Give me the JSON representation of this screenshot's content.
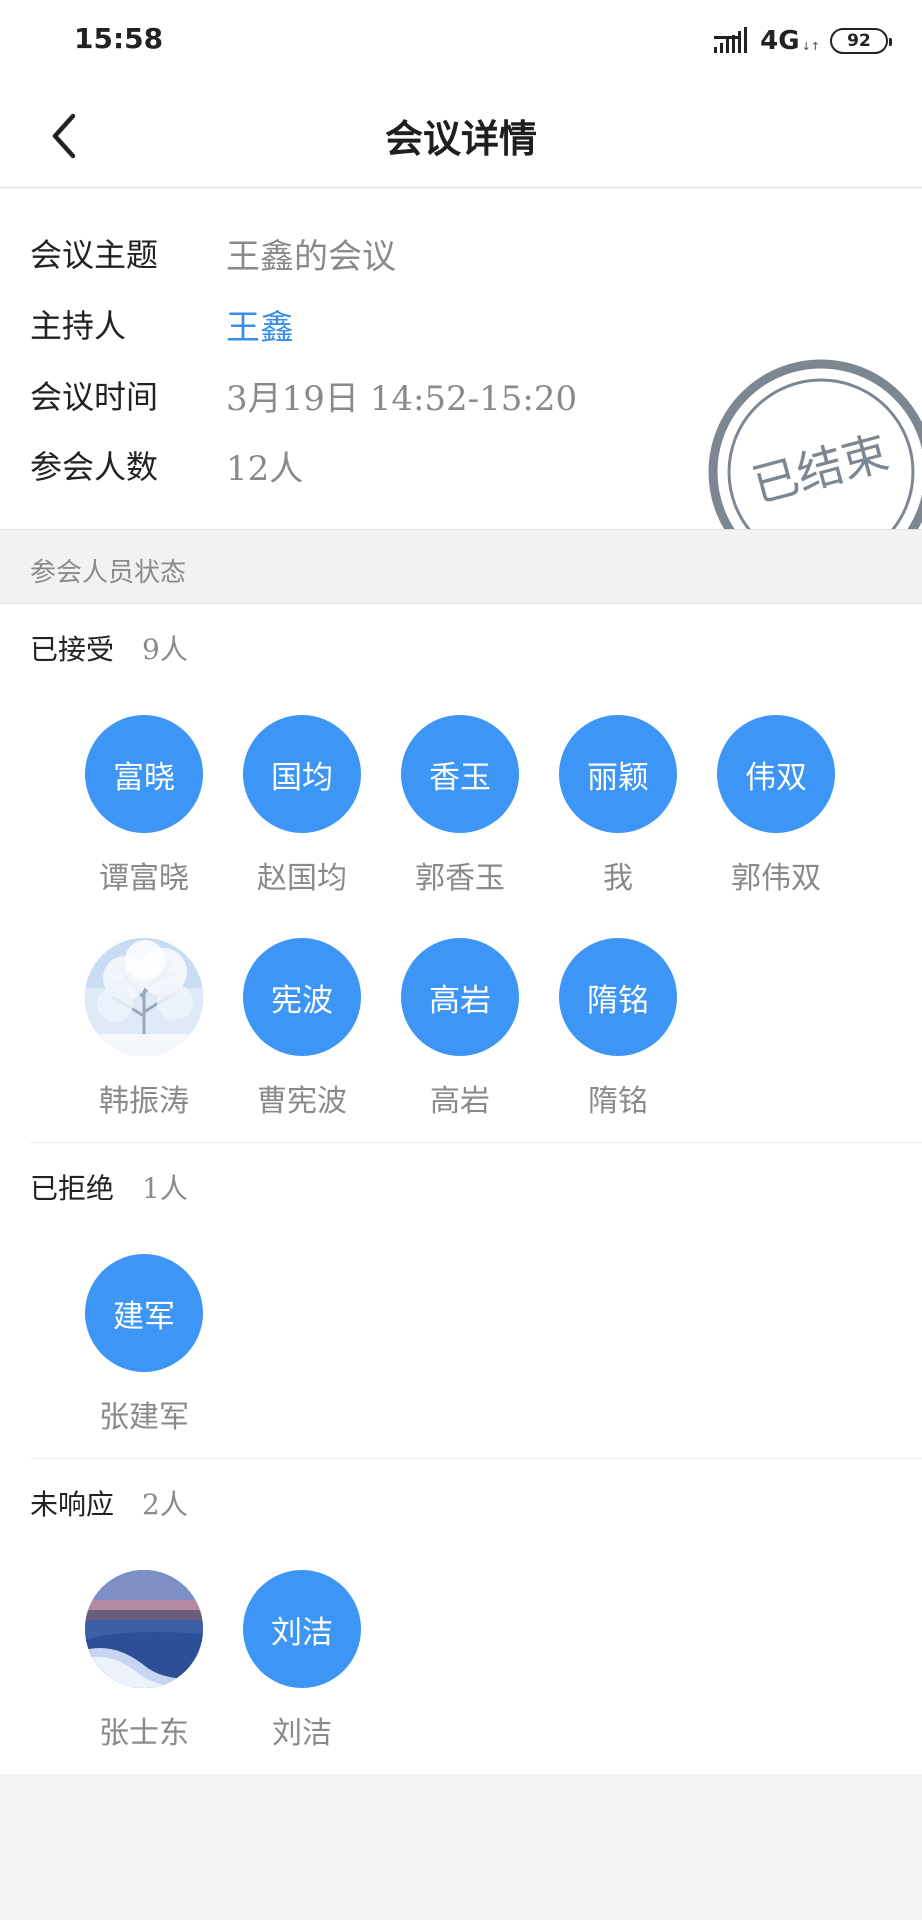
{
  "status_bar": {
    "time": "15:58",
    "network": "4G",
    "network_arrows": "↓↑",
    "battery": "92"
  },
  "nav": {
    "back_icon": "chevron-left-icon",
    "title": "会议详情"
  },
  "meeting": {
    "topic_label": "会议主题",
    "topic": "王鑫的会议",
    "host_label": "主持人",
    "host": "王鑫",
    "time_label": "会议时间",
    "time": "3月19日 14:52-15:20",
    "count_label": "参会人数",
    "count": "12人",
    "stamp_text": "已结束",
    "stamp_color": "#7d8792"
  },
  "section_title": "参会人员状态",
  "accent_color": "#3d95f5",
  "groups": [
    {
      "name": "已接受",
      "count": "9人",
      "members": [
        {
          "initials": "富晓",
          "name": "谭富晓"
        },
        {
          "initials": "国均",
          "name": "赵国均"
        },
        {
          "initials": "香玉",
          "name": "郭香玉"
        },
        {
          "initials": "丽颖",
          "name": "我"
        },
        {
          "initials": "伟双",
          "name": "郭伟双"
        },
        {
          "initials": "",
          "name": "韩振涛",
          "photo": "snow-tree-photo"
        },
        {
          "initials": "宪波",
          "name": "曹宪波"
        },
        {
          "initials": "高岩",
          "name": "高岩"
        },
        {
          "initials": "隋铭",
          "name": "隋铭"
        }
      ]
    },
    {
      "name": "已拒绝",
      "count": "1人",
      "members": [
        {
          "initials": "建军",
          "name": "张建军"
        }
      ]
    },
    {
      "name": "未响应",
      "count": "2人",
      "members": [
        {
          "initials": "",
          "name": "张士东",
          "photo": "lake-photo"
        },
        {
          "initials": "刘洁",
          "name": "刘洁"
        }
      ]
    }
  ]
}
